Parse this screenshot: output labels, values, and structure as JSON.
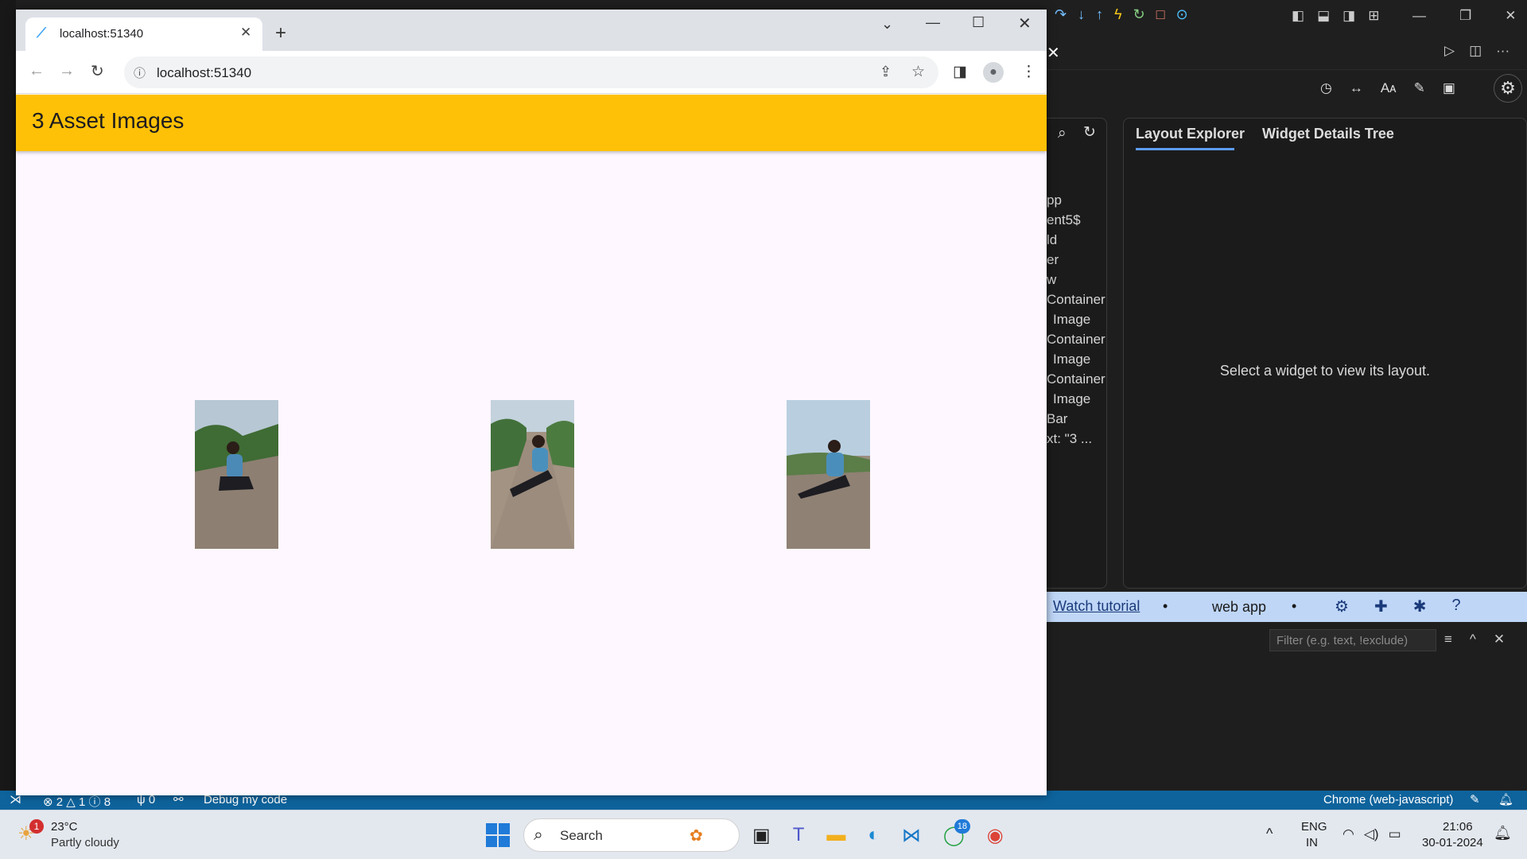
{
  "browser": {
    "tab_title": "localhost:51340",
    "url": "localhost:51340"
  },
  "app": {
    "title": "3 Asset Images",
    "accent_color": "#ffc107"
  },
  "devtools": {
    "tree_items": [
      "pp",
      "ent5$",
      "ld",
      "er",
      "w",
      "Container",
      "Image",
      "Container",
      "Image",
      "Container",
      "Image",
      "Bar",
      "xt: \"3 ..."
    ],
    "tabs": [
      "Layout Explorer",
      "Widget Details Tree"
    ],
    "layout_message": "Select a widget to view its layout.",
    "watch_tutorial": "Watch tutorial",
    "mode": "web app",
    "filter_placeholder": "Filter (e.g. text, !exclude)"
  },
  "status_bar": {
    "errors": "2",
    "warnings": "1",
    "infos": "8",
    "ports": "0",
    "debug": "Debug my code",
    "target": "Chrome (web-javascript)"
  },
  "taskbar": {
    "weather_badge": "1",
    "temperature": "23°C",
    "weather_desc": "Partly cloudy",
    "search_label": "Search",
    "whatsapp_badge": "18",
    "language": "ENG",
    "region": "IN",
    "time": "21:06",
    "date": "30-01-2024"
  }
}
